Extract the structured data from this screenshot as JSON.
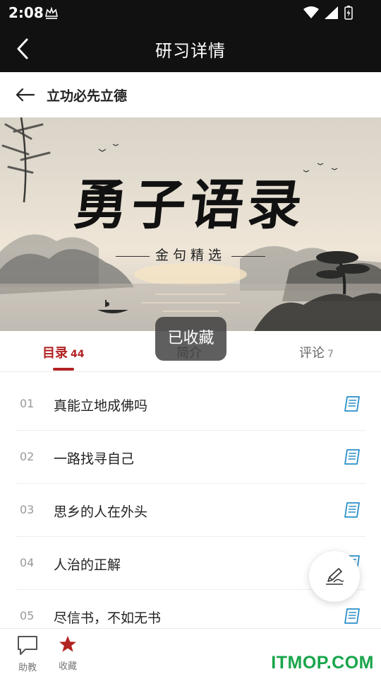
{
  "status": {
    "time": "2:08",
    "icons": [
      "wifi-icon",
      "signal-icon",
      "battery-icon"
    ]
  },
  "header": {
    "title": "研习详情"
  },
  "subheader": {
    "title": "立功必先立德"
  },
  "banner": {
    "title": "勇子语录",
    "subtitle": "金句精选"
  },
  "tabs": [
    {
      "label": "目录",
      "count": "44",
      "active": true
    },
    {
      "label": "简介",
      "count": "",
      "active": false
    },
    {
      "label": "评论",
      "count": "7",
      "active": false
    }
  ],
  "toast": "已收藏",
  "chapters": [
    {
      "num": "01",
      "title": "真能立地成佛吗"
    },
    {
      "num": "02",
      "title": "一路找寻自己"
    },
    {
      "num": "03",
      "title": "思乡的人在外头"
    },
    {
      "num": "04",
      "title": "人治的正解"
    },
    {
      "num": "05",
      "title": "尽信书，不如无书"
    }
  ],
  "bottom": {
    "assist_label": "助教",
    "favorite_label": "收藏"
  },
  "watermark": "ITMOP.COM",
  "colors": {
    "accent": "#b22222",
    "doc_icon": "#2a8fc9",
    "watermark": "#18a54b"
  }
}
